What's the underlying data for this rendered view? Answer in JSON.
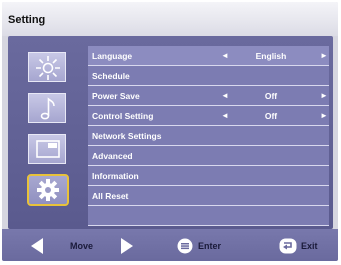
{
  "window": {
    "title": "Setting"
  },
  "categories": [
    {
      "icon": "sun-icon",
      "selected": false
    },
    {
      "icon": "music-note-icon",
      "selected": false
    },
    {
      "icon": "screen-icon",
      "selected": false
    },
    {
      "icon": "gear-icon",
      "selected": true
    }
  ],
  "menu": {
    "items": [
      {
        "label": "Language",
        "value": "English",
        "has_arrows": true
      },
      {
        "label": "Schedule",
        "value": "",
        "has_arrows": false
      },
      {
        "label": "Power Save",
        "value": "Off",
        "has_arrows": true
      },
      {
        "label": "Control Setting",
        "value": "Off",
        "has_arrows": true
      },
      {
        "label": "Network Settings",
        "value": "",
        "has_arrows": false
      },
      {
        "label": "Advanced",
        "value": "",
        "has_arrows": false
      },
      {
        "label": "Information",
        "value": "",
        "has_arrows": false
      },
      {
        "label": "All Reset",
        "value": "",
        "has_arrows": false
      },
      {
        "label": "",
        "value": "",
        "has_arrows": false
      }
    ],
    "left_arrow": "◄",
    "right_arrow": "►"
  },
  "footer": {
    "move_label": "Move",
    "enter_label": "Enter",
    "exit_label": "Exit"
  },
  "colors": {
    "selection_border": "#e8c23a",
    "panel": "#6a6a9e",
    "menu_bg": "#7c7cb2"
  }
}
